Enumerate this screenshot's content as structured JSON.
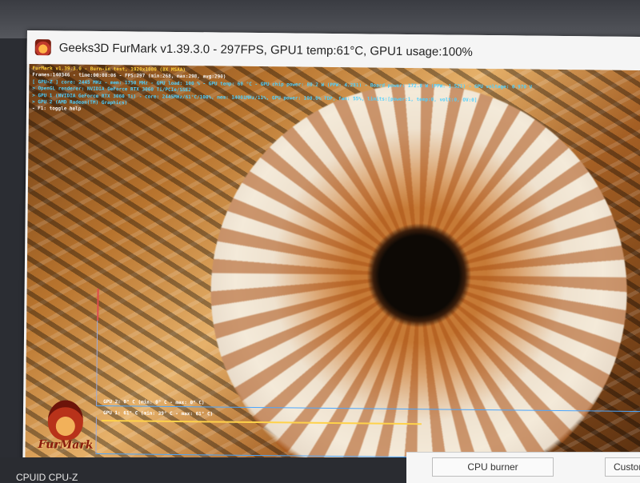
{
  "window": {
    "title": "Geeks3D FurMark v1.39.3.0 - 297FPS, GPU1 temp:61°C, GPU1 usage:100%"
  },
  "osd": {
    "lines": [
      "FurMark v1.39.3.0 - Burn-in test, 1920x1080 (8X MSAA)",
      "Frames:140346 - time:00:08:06 - FPS:297 (min:268, max:298, avg:290)",
      "[ GPU-Z ] core: 2445 MHz - mem: 1750 MHz - GPU load: 100 % - GPU temp: 60 °C - GPU chip power: 80.2 W (PPW: 4.281) - Board power: 172.8 W (PPW: 1.521) - GPU voltage: 0.970 V",
      "> OpenGL renderer: NVIDIA GeForce RTX 3060 Ti/PCIe/SSE2",
      "> GPU 1 (NVIDIA GeForce RTX 3060 Ti) - core: 2445MHz/61°C/100%, mem: 14001MHz/11%, GPU power: 100.0% TDP, fan: 55%, limits:[power:1, temp:0, volt:0, OV:0]",
      "> GPU 2 (AMD Radeon(TM) Graphics)",
      "- F1: toggle help"
    ]
  },
  "graphs": {
    "gpu2_label": "GPU 2: 0° C (min: 0° C - max: 0° C)",
    "gpu1_label": "GPU 1: 61° C (min: 39° C - max: 61° C)"
  },
  "logo": {
    "text": "FurMark"
  },
  "background": {
    "bottom_left_text": "CPUID CPU-Z"
  },
  "panel": {
    "cpu_burner_label": "CPU burner",
    "custom_label": "Custom"
  },
  "colors": {
    "osd_title": "#ffd23a",
    "osd_info": "#4fd0ff",
    "graph_line": "#4aa6ff",
    "temp_line": "#ffd24a"
  }
}
